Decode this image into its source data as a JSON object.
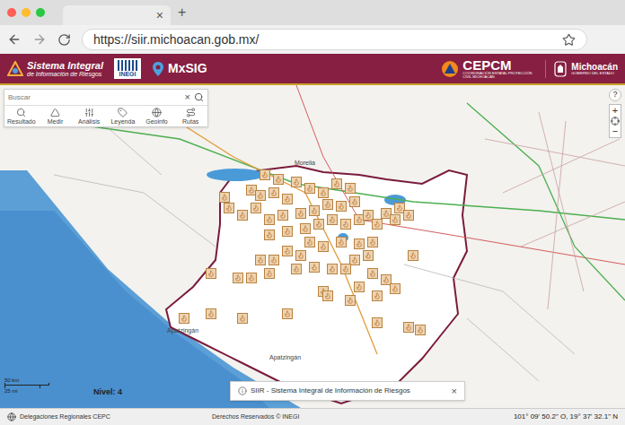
{
  "browser": {
    "tab_close": "×",
    "new_tab": "+",
    "url": "https://siir.michoacan.gob.mx/"
  },
  "header": {
    "app_title_line1": "Sistema Integral",
    "app_title_line2": "de Información de Riesgos",
    "inegi": "INEGI",
    "mxsig": "MxSIG",
    "cepcm": "CEPCM",
    "cepcm_subtitle": "COORDINACIÓN ESTATAL PROTECCIÓN CIVIL MICHOACÁN",
    "state": "Michoacán",
    "state_subtitle": "GOBIERNO DEL ESTADO"
  },
  "search": {
    "placeholder": "Buscar",
    "clear": "×"
  },
  "tools": [
    {
      "label": "Resultado"
    },
    {
      "label": "Medir"
    },
    {
      "label": "Análisis"
    },
    {
      "label": "Leyenda"
    },
    {
      "label": "Geoinfo"
    },
    {
      "label": "Rutas"
    }
  ],
  "zoom": {
    "help": "?",
    "in": "+",
    "out": "−"
  },
  "places": [
    {
      "name": "Morelia"
    },
    {
      "name": "Apatzingán"
    },
    {
      "name": "Apatzingán"
    }
  ],
  "scale": {
    "km": "50 km",
    "mi": "25 mi"
  },
  "level": "Nivel: 4",
  "popup": {
    "title": "SIIR - Sistema Integral de Información de Riesgos",
    "close": "×"
  },
  "footer": {
    "left": "Delegaciones Regionales CEPC",
    "center": "Derechos Reservados © INEGI",
    "coords": "101° 09' 50.2\" O, 19° 37' 32.1\" N"
  }
}
